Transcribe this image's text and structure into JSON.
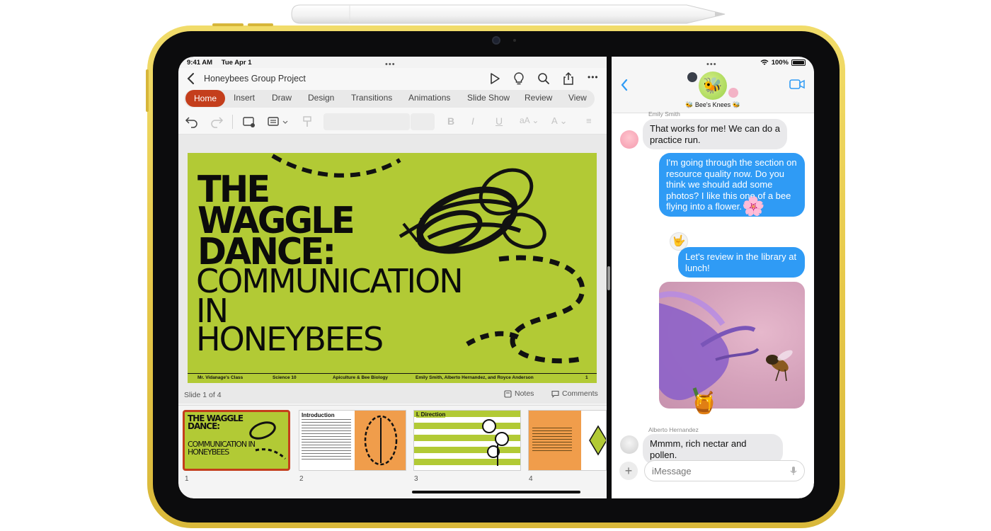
{
  "status": {
    "time": "9:41 AM",
    "date": "Tue Apr 1",
    "battery": "100%"
  },
  "powerpoint": {
    "doc_title": "Honeybees Group Project",
    "tabs": [
      "Home",
      "Insert",
      "Draw",
      "Design",
      "Transitions",
      "Animations",
      "Slide Show",
      "Review",
      "View"
    ],
    "active_tab": "Home",
    "slide": {
      "title_bold": [
        "THE",
        "WAGGLE",
        "DANCE:"
      ],
      "title_thin": [
        "COMMUNICATION",
        "IN",
        "HONEYBEES"
      ],
      "footer": [
        "Mr. Vidanage's Class",
        "Science 10",
        "Apiculture & Bee Biology",
        "Emily Smith, Alberto Hernandez, and Royce Anderson",
        "1"
      ]
    },
    "slide_indicator": "Slide 1 of 4",
    "notes_label": "Notes",
    "comments_label": "Comments",
    "thumbnails": [
      {
        "num": "1",
        "title": "THE WAGGLE DANCE:",
        "subtitle": "COMMUNICATION IN HONEYBEES"
      },
      {
        "num": "2",
        "title": "Introduction"
      },
      {
        "num": "3",
        "title": "I. Direction"
      },
      {
        "num": "4"
      }
    ]
  },
  "messages": {
    "group_name": "🐝 Bee's Knees 🐝",
    "items": [
      {
        "sender": "Emily Smith",
        "text": "That works for me! We can do a practice run.",
        "direction": "in"
      },
      {
        "text": "I'm going through the section on resource quality now. Do you think we should add some photos? I like this one of a bee flying into a flower.",
        "direction": "out",
        "sticker": "🌸"
      },
      {
        "text": "Let's review in the library at lunch!",
        "direction": "out",
        "reaction": "🤟"
      },
      {
        "type": "photo",
        "direction": "out",
        "sticker": "🍯"
      },
      {
        "sender": "Alberto Hernandez",
        "text": "Mmmm, rich nectar and pollen.",
        "direction": "in"
      }
    ],
    "input_placeholder": "iMessage"
  },
  "colors": {
    "ppt_accent": "#c43e1c",
    "slide_bg": "#b2ca35",
    "imessage_blue": "#2f9bf5",
    "ipad_body": "#e7c94a"
  },
  "icons": [
    "back-chevron-icon",
    "play-icon",
    "lightbulb-icon",
    "search-icon",
    "share-icon",
    "more-icon",
    "undo-icon",
    "redo-icon",
    "microphone-icon",
    "video-call-icon",
    "plus-icon",
    "wifi-icon",
    "battery-icon"
  ]
}
